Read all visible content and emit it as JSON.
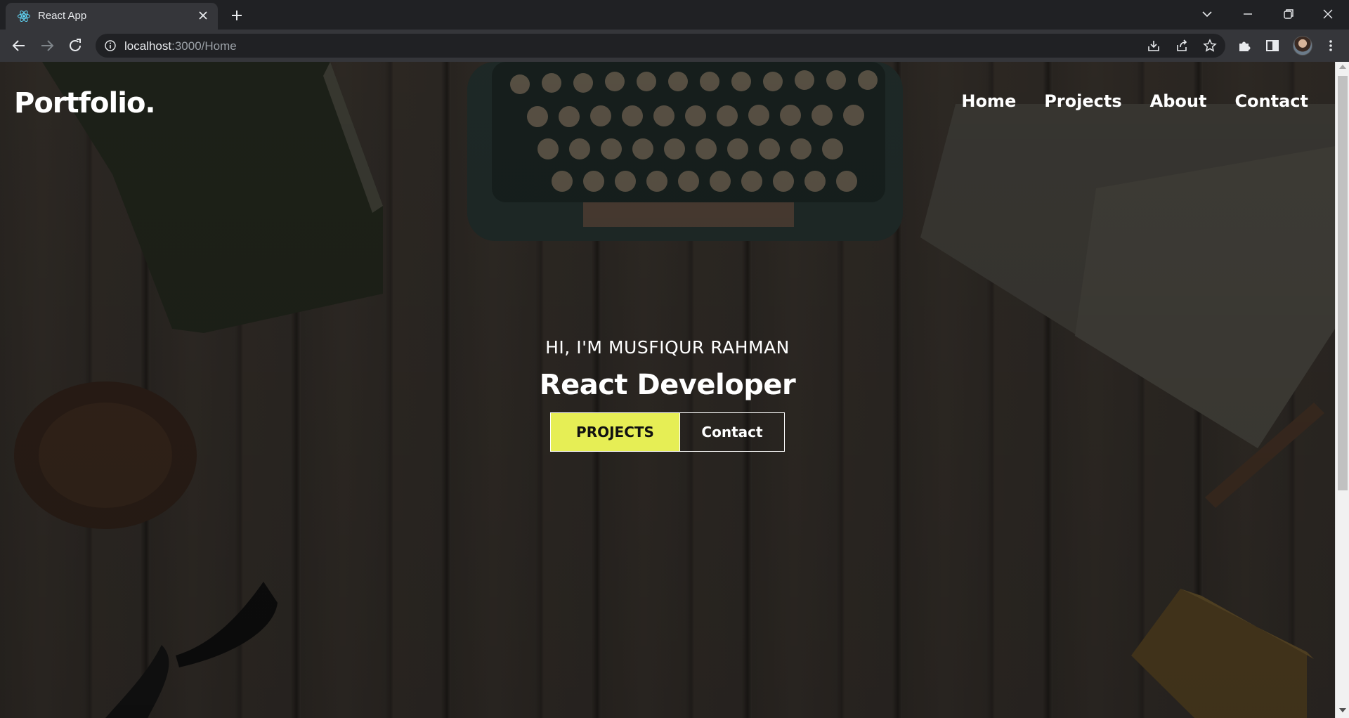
{
  "browser": {
    "tab_title": "React App",
    "url_host": "localhost",
    "url_rest": ":3000/Home"
  },
  "page": {
    "logo": "Portfolio.",
    "nav": [
      "Home",
      "Projects",
      "About",
      "Contact"
    ],
    "hero": {
      "greeting": "HI, I'M MUSFIQUR RAHMAN",
      "title": "React Developer",
      "primary_button": "PROJECTS",
      "secondary_button": "Contact"
    },
    "colors": {
      "accent": "#e6ee55",
      "text": "#ffffff",
      "chrome_dark": "#202124",
      "chrome_toolbar": "#35363a"
    }
  },
  "icons": {
    "tab": [
      "react-icon",
      "close-icon",
      "plus-icon"
    ],
    "window": [
      "chevron-down-icon",
      "minimize-icon",
      "restore-icon",
      "close-icon"
    ],
    "navigation": [
      "back-icon",
      "forward-icon",
      "reload-icon",
      "info-icon"
    ],
    "omnibox": [
      "install-icon",
      "share-icon",
      "star-icon"
    ],
    "toolbar": [
      "extensions-icon",
      "side-panel-icon",
      "avatar",
      "kebab-menu-icon"
    ]
  }
}
